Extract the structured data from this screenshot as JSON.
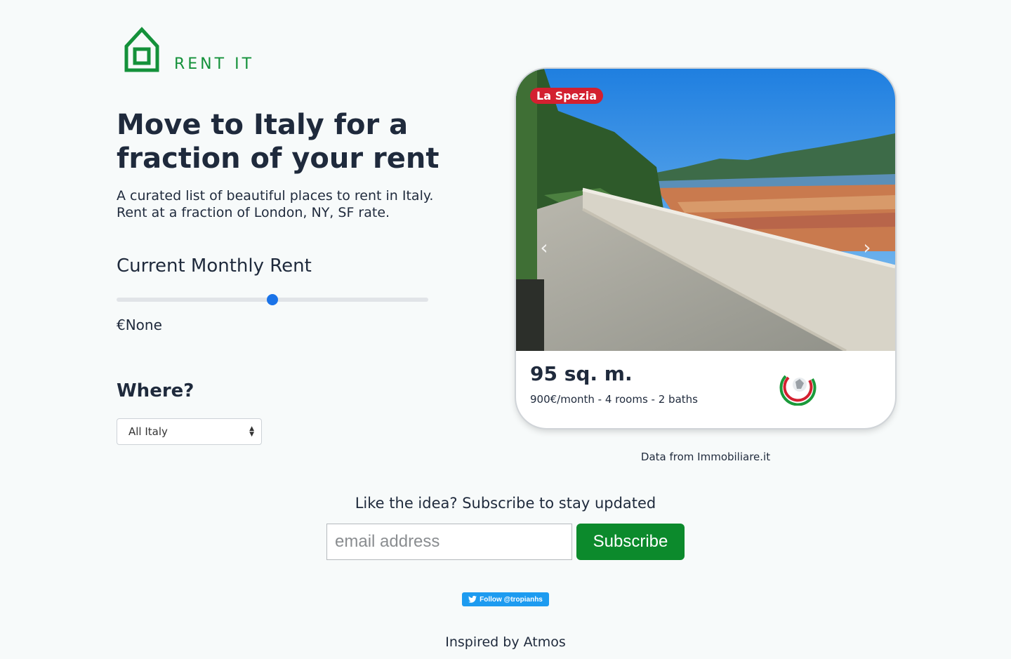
{
  "brand": {
    "name": "RENT IT",
    "color": "#14913a",
    "icon": "house-icon"
  },
  "hero": {
    "headline": "Move to Italy for a fraction of your rent",
    "subtitle_line1": "A curated list of beautiful places to rent in Italy.",
    "subtitle_line2": "Rent at a fraction of London, NY, SF rate."
  },
  "rent": {
    "label": "Current Monthly Rent",
    "slider_value_fraction": 0.5,
    "value_text": "€None",
    "accent": "#1a73e8"
  },
  "where": {
    "label": "Where?",
    "selected": "All Italy"
  },
  "listing": {
    "city": "La Spezia",
    "area": "95 sq. m.",
    "details": "900€/month - 4 rooms - 2 baths",
    "badge_color": "#d32030",
    "prev_icon": "chevron-left-icon",
    "next_icon": "chevron-right-icon",
    "agency_icon": "agency-logo-icon"
  },
  "data_source": "Data from Immobiliare.it",
  "subscribe": {
    "heading": "Like the idea? Subscribe to stay updated",
    "placeholder": "email address",
    "button_label": "Subscribe",
    "button_color": "#0c8a2c"
  },
  "twitter": {
    "label": "Follow @tropianhs",
    "icon": "twitter-bird-icon"
  },
  "footer": {
    "inspired": "Inspired by Atmos"
  }
}
